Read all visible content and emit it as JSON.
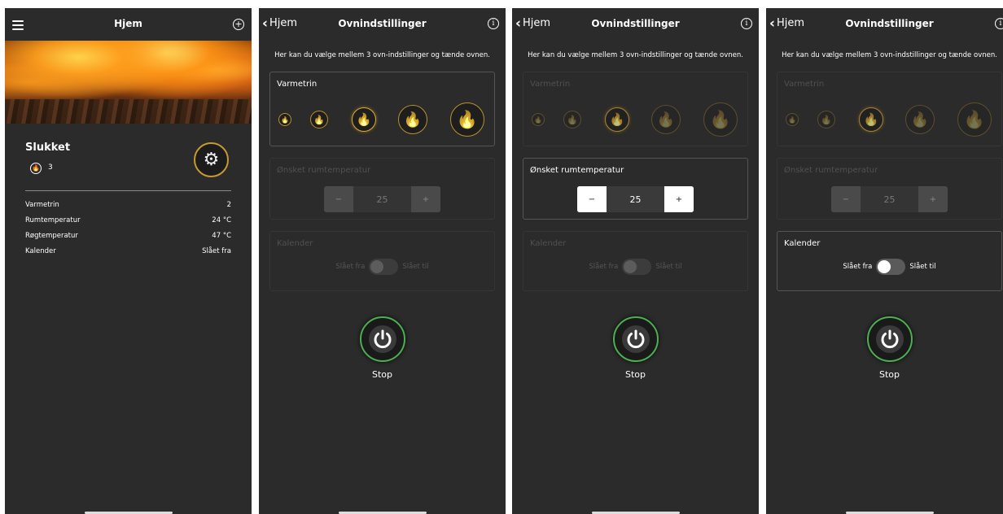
{
  "home": {
    "title": "Hjem",
    "status": "Slukket",
    "level": "3",
    "rows": [
      {
        "label": "Varmetrin",
        "value": "2"
      },
      {
        "label": "Rumtemperatur",
        "value": "24 °C"
      },
      {
        "label": "Røgtemperatur",
        "value": "47 °C"
      },
      {
        "label": "Kalender",
        "value": "Slået fra"
      }
    ]
  },
  "settings": {
    "back_label": "Hjem",
    "title": "Ovnindstillinger",
    "intro": "Her kan du vælge mellem 3 ovn-indstillinger og tænde ovnen.",
    "heat_label": "Varmetrin",
    "heat_levels": [
      1,
      2,
      3,
      4,
      5
    ],
    "heat_selected": 3,
    "temp_label": "Ønsket rumtemperatur",
    "temp_minus": "−",
    "temp_value": "25",
    "temp_plus": "+",
    "calendar_label": "Kalender",
    "calendar_off": "Slået fra",
    "calendar_on": "Slået til",
    "stop_label": "Stop"
  },
  "screens": [
    {
      "id": "s2",
      "active_section": "heat"
    },
    {
      "id": "s3",
      "active_section": "temp"
    },
    {
      "id": "s4",
      "active_section": "calendar"
    }
  ],
  "colors": {
    "accent_gold": "#d8a93a",
    "power_green": "#4caf50",
    "background": "#2b2b2b"
  },
  "icons": [
    "menu-icon",
    "add-icon",
    "back-chevron-icon",
    "info-icon",
    "flame-icon",
    "gear-icon",
    "power-icon"
  ]
}
